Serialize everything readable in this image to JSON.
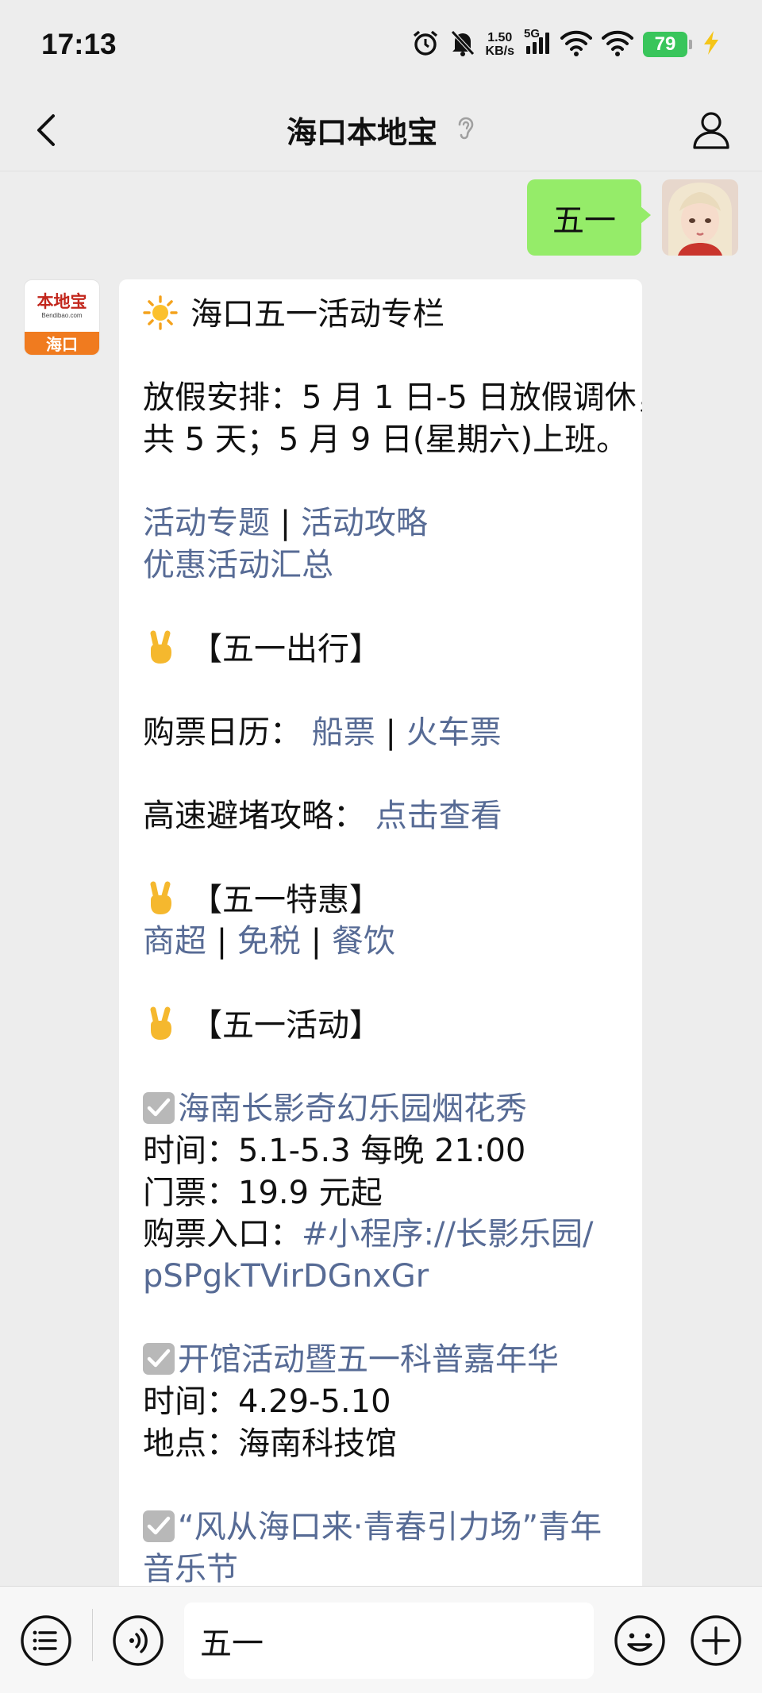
{
  "status_bar": {
    "time": "17:13",
    "speed_value": "1.50",
    "speed_unit": "KB/s",
    "network": "5G",
    "battery": "79",
    "icons": [
      "alarm-icon",
      "mute-bell-icon",
      "signal-icon",
      "wifi-icon",
      "wifi-icon",
      "battery-icon",
      "charging-icon"
    ]
  },
  "nav": {
    "title": "海口本地宝",
    "back_icon": "chevron-left-icon",
    "listen_icon": "ear-icon",
    "profile_icon": "person-icon"
  },
  "outgoing_message": {
    "text": "五一"
  },
  "incoming_message": {
    "sender_logo": {
      "cn": "本地宝",
      "en": "Bendibao.com",
      "city": "海口"
    },
    "header": "海口五一活动专栏",
    "holiday_line1": "放假安排：5 月 1 日-5 日放假调休，",
    "holiday_line2": "共 5 天；5 月 9 日(星期六)上班。",
    "topic_link": "活动专题",
    "guide_link": "活动攻略",
    "deals_link": "优惠活动汇总",
    "travel_heading": "【五一出行】",
    "ticket_label": "购票日历：",
    "ship_link": "船票",
    "train_link": "火车票",
    "highway_label": "高速避堵攻略：",
    "highway_link": "点击查看",
    "special_heading": "【五一特惠】",
    "mall_link": "商超",
    "dutyfree_link": "免税",
    "dining_link": "餐饮",
    "activity_heading": "【五一活动】",
    "event1": {
      "title": "海南长影奇幻乐园烟花秀",
      "time": "时间：5.1-5.3 每晚 21:00",
      "ticket": "门票：19.9 元起",
      "entry_label": "购票入口：",
      "entry_link_1": "#小程序://长影乐园/",
      "entry_link_2": "pSPgkTVirDGnxGr"
    },
    "event2": {
      "title": "开馆活动暨五一科普嘉年华",
      "time": "时间：4.29-5.10",
      "place": "地点：海南科技馆"
    },
    "event3": {
      "title_1": "“风从海口来·青春引力场”青年",
      "title_2": "音乐节"
    },
    "separator": "|"
  },
  "input_bar": {
    "value": "五一",
    "left_icon": "menu-list-icon",
    "voice_icon": "voice-icon",
    "emoji_icon": "emoji-icon",
    "plus_icon": "plus-icon"
  },
  "colors": {
    "background": "#ededed",
    "outgoing_bubble": "#95ec69",
    "link": "#576b95",
    "battery": "#39c55b",
    "logo_orange": "#f07b1f",
    "logo_red": "#c2261c"
  }
}
